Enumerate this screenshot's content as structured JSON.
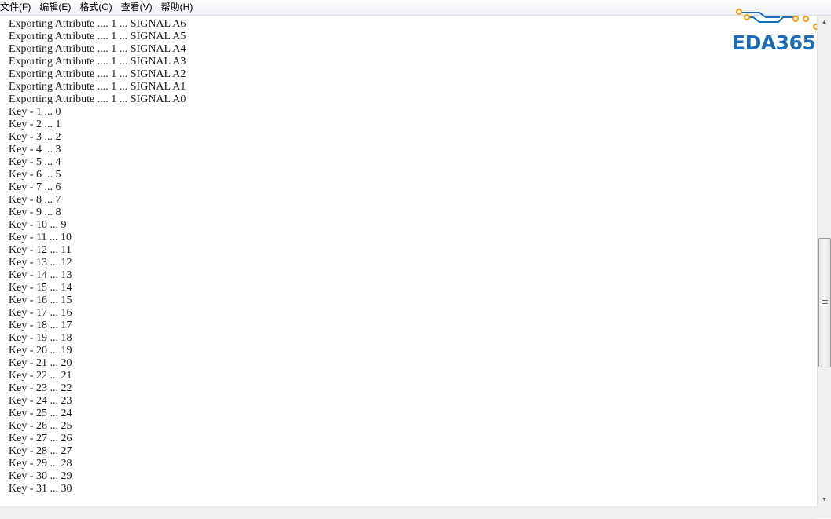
{
  "menubar": {
    "items": [
      "文件(F)",
      "编辑(E)",
      "格式(O)",
      "查看(V)",
      "帮助(H)"
    ]
  },
  "logo": {
    "text": "EDA365",
    "color": "#1b6bb5",
    "accent": "#f2a21b"
  },
  "editor": {
    "lines": [
      "Exporting Attribute .... 1 ... SIGNAL A6",
      "Exporting Attribute .... 1 ... SIGNAL A5",
      "Exporting Attribute .... 1 ... SIGNAL A4",
      "Exporting Attribute .... 1 ... SIGNAL A3",
      "Exporting Attribute .... 1 ... SIGNAL A2",
      "Exporting Attribute .... 1 ... SIGNAL A1",
      "Exporting Attribute .... 1 ... SIGNAL A0",
      "Key - 1 ... 0",
      "Key - 2 ... 1",
      "Key - 3 ... 2",
      "Key - 4 ... 3",
      "Key - 5 ... 4",
      "Key - 6 ... 5",
      "Key - 7 ... 6",
      "Key - 8 ... 7",
      "Key - 9 ... 8",
      "Key - 10 ... 9",
      "Key - 11 ... 10",
      "Key - 12 ... 11",
      "Key - 13 ... 12",
      "Key - 14 ... 13",
      "Key - 15 ... 14",
      "Key - 16 ... 15",
      "Key - 17 ... 16",
      "Key - 18 ... 17",
      "Key - 19 ... 18",
      "Key - 20 ... 19",
      "Key - 21 ... 20",
      "Key - 22 ... 21",
      "Key - 23 ... 22",
      "Key - 24 ... 23",
      "Key - 25 ... 24",
      "Key - 26 ... 25",
      "Key - 27 ... 26",
      "Key - 28 ... 27",
      "Key - 29 ... 28",
      "Key - 30 ... 29",
      "Key - 31 ... 30"
    ]
  }
}
